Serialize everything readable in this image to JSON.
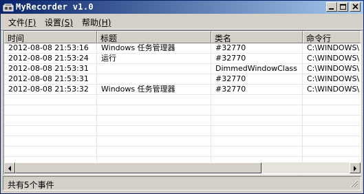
{
  "window": {
    "title": "MyRecorder v1.0"
  },
  "menu": [
    {
      "label": "文件",
      "hotkey": "(F)"
    },
    {
      "label": "设置",
      "hotkey": "(S)"
    },
    {
      "label": "帮助",
      "hotkey": "(H)"
    }
  ],
  "table": {
    "columns": [
      "时间",
      "标题",
      "类名",
      "命令行"
    ],
    "rows": [
      [
        "2012-08-08 21:53:16",
        "Windows 任务管理器",
        "#32770",
        "C:\\WINDOWS\\"
      ],
      [
        "2012-08-08 21:53:24",
        "运行",
        "#32770",
        "C:\\WINDOWS\\"
      ],
      [
        "2012-08-08 21:53:31",
        "",
        "DimmedWindowClass",
        "C:\\WINDOWS\\"
      ],
      [
        "2012-08-08 21:53:31",
        "",
        "#32770",
        "C:\\WINDOWS\\"
      ],
      [
        "2012-08-08 21:53:32",
        "Windows 任务管理器",
        "#32770",
        "C:\\WINDOWS\\"
      ]
    ]
  },
  "status": {
    "text": "共有5个事件"
  },
  "icons": {
    "app": "recorder-icon",
    "minimize": "minimize-icon",
    "maximize": "maximize-icon",
    "close": "close-icon",
    "scroll_left": "arrow-left-icon",
    "scroll_right": "arrow-right-icon",
    "grip": "resize-grip-icon"
  },
  "colors": {
    "title_bar_start": "#0a246a",
    "title_bar_end": "#a6caf0",
    "chrome": "#d4d0c8"
  }
}
